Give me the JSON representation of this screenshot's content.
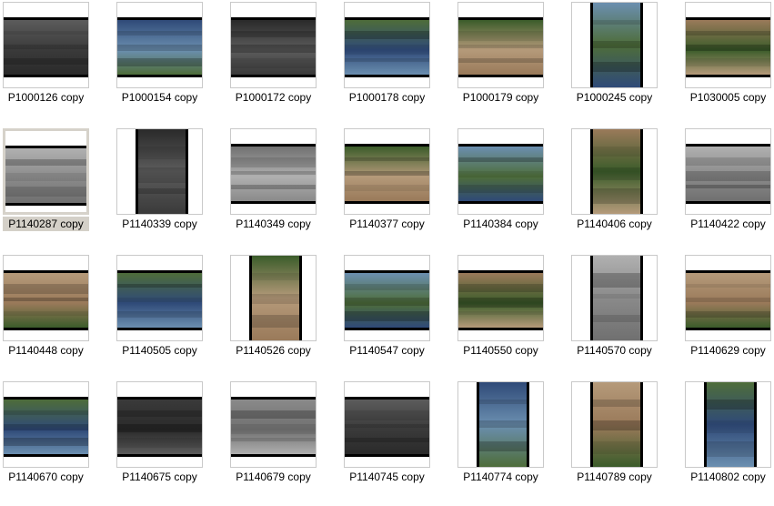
{
  "window": {
    "title": ""
  },
  "thumbnails": [
    {
      "name": "P1000126 copy",
      "orient": "land",
      "tone": "bw",
      "selected": false
    },
    {
      "name": "P1000154 copy",
      "orient": "land",
      "tone": "color",
      "selected": false
    },
    {
      "name": "P1000172 copy",
      "orient": "land",
      "tone": "bw",
      "selected": false
    },
    {
      "name": "P1000178 copy",
      "orient": "land",
      "tone": "color",
      "selected": false
    },
    {
      "name": "P1000179 copy",
      "orient": "land",
      "tone": "color",
      "selected": false
    },
    {
      "name": "P1000245 copy",
      "orient": "port",
      "tone": "color",
      "selected": false
    },
    {
      "name": "P1030005 copy",
      "orient": "land",
      "tone": "color",
      "selected": false
    },
    {
      "name": "P1140287 copy",
      "orient": "land",
      "tone": "bw",
      "selected": true
    },
    {
      "name": "P1140339 copy",
      "orient": "port",
      "tone": "bw",
      "selected": false
    },
    {
      "name": "P1140349 copy",
      "orient": "land",
      "tone": "bw",
      "selected": false
    },
    {
      "name": "P1140377 copy",
      "orient": "land",
      "tone": "color",
      "selected": false
    },
    {
      "name": "P1140384 copy",
      "orient": "land",
      "tone": "color",
      "selected": false
    },
    {
      "name": "P1140406 copy",
      "orient": "port",
      "tone": "color",
      "selected": false
    },
    {
      "name": "P1140422 copy",
      "orient": "land",
      "tone": "bw",
      "selected": false
    },
    {
      "name": "P1140448 copy",
      "orient": "land",
      "tone": "color",
      "selected": false
    },
    {
      "name": "P1140505 copy",
      "orient": "land",
      "tone": "color",
      "selected": false
    },
    {
      "name": "P1140526 copy",
      "orient": "port",
      "tone": "color",
      "selected": false
    },
    {
      "name": "P1140547 copy",
      "orient": "land",
      "tone": "color",
      "selected": false
    },
    {
      "name": "P1140550 copy",
      "orient": "land",
      "tone": "color",
      "selected": false
    },
    {
      "name": "P1140570 copy",
      "orient": "port",
      "tone": "bw",
      "selected": false
    },
    {
      "name": "P1140629 copy",
      "orient": "land",
      "tone": "color",
      "selected": false
    },
    {
      "name": "P1140670 copy",
      "orient": "land",
      "tone": "color",
      "selected": false
    },
    {
      "name": "P1140675 copy",
      "orient": "land",
      "tone": "bw",
      "selected": false
    },
    {
      "name": "P1140679 copy",
      "orient": "land",
      "tone": "bw",
      "selected": false
    },
    {
      "name": "P1140745 copy",
      "orient": "land",
      "tone": "bw",
      "selected": false
    },
    {
      "name": "P1140774 copy",
      "orient": "port",
      "tone": "color",
      "selected": false
    },
    {
      "name": "P1140789 copy",
      "orient": "port",
      "tone": "color",
      "selected": false
    },
    {
      "name": "P1140802 copy",
      "orient": "port",
      "tone": "color",
      "selected": false
    }
  ],
  "colors": {
    "border": "#c9c9c9",
    "selected_border": "#d6d2ca",
    "selected_caption_bg": "#d4d0c8"
  }
}
